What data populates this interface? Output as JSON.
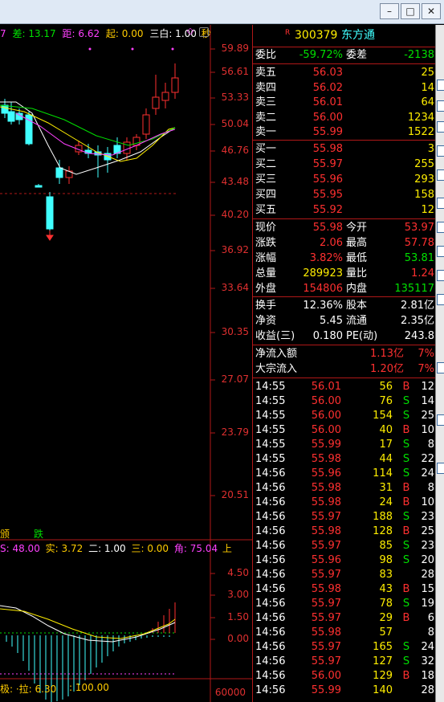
{
  "window": {
    "minimize_label": "–",
    "maximize_label": "□",
    "close_label": "✕"
  },
  "chart_header": {
    "items": [
      {
        "label": "7",
        "color": "#ff40ff"
      },
      {
        "label": "差: 13.17",
        "color": "#00e000"
      },
      {
        "label": "距: 6.62",
        "color": "#ff40ff"
      },
      {
        "label": "起: 0.00",
        "color": "#ffcc00"
      },
      {
        "label": "三白: 1.00",
        "color": "#ffffff"
      },
      {
        "label": "秒",
        "color": "#ffcc00"
      }
    ]
  },
  "price_axis": [
    "59.89",
    "56.61",
    "53.33",
    "50.04",
    "46.76",
    "43.48",
    "40.20",
    "36.92",
    "33.64",
    "30.35",
    "27.07",
    "23.79",
    "20.51"
  ],
  "lower_labels": {
    "left": "颁",
    "right": "跌"
  },
  "indicator_header": [
    {
      "label": "S: 48.00",
      "color": "#ff40ff"
    },
    {
      "label": "实: 3.72",
      "color": "#ffcc00"
    },
    {
      "label": "二: 1.00",
      "color": "#ffffff"
    },
    {
      "label": "三: 0.00",
      "color": "#ffcc00"
    },
    {
      "label": "角: 75.04",
      "color": "#ff40ff"
    },
    {
      "label": "上",
      "color": "#ffcc00"
    }
  ],
  "indicator_axis": [
    "4.50",
    "3.00",
    "1.50",
    "0.00"
  ],
  "indicator_footer": {
    "left": "极: ·拉: 6.30",
    "right": ": 100.00"
  },
  "volume_axis": "60000",
  "stock": {
    "code": "300379",
    "name": "东方通",
    "badge": "R"
  },
  "weibi": {
    "label1": "委比",
    "value1": "-59.72%",
    "label2": "委差",
    "value2": "-2138"
  },
  "asks": [
    {
      "label": "卖五",
      "price": "56.03",
      "vol": "25"
    },
    {
      "label": "卖四",
      "price": "56.02",
      "vol": "14"
    },
    {
      "label": "卖三",
      "price": "56.01",
      "vol": "64"
    },
    {
      "label": "卖二",
      "price": "56.00",
      "vol": "1234"
    },
    {
      "label": "卖一",
      "price": "55.99",
      "vol": "1522"
    }
  ],
  "bids": [
    {
      "label": "买一",
      "price": "55.98",
      "vol": "3"
    },
    {
      "label": "买二",
      "price": "55.97",
      "vol": "255"
    },
    {
      "label": "买三",
      "price": "55.96",
      "vol": "293"
    },
    {
      "label": "买四",
      "price": "55.95",
      "vol": "158"
    },
    {
      "label": "买五",
      "price": "55.92",
      "vol": "12"
    }
  ],
  "quote": [
    {
      "l1": "现价",
      "v1": "55.98",
      "c1": "#ff3030",
      "l2": "今开",
      "v2": "53.97",
      "c2": "#ff3030"
    },
    {
      "l1": "涨跌",
      "v1": "2.06",
      "c1": "#ff3030",
      "l2": "最高",
      "v2": "57.78",
      "c2": "#ff3030"
    },
    {
      "l1": "涨幅",
      "v1": "3.82%",
      "c1": "#ff3030",
      "l2": "最低",
      "v2": "53.81",
      "c2": "#00e000"
    },
    {
      "l1": "总量",
      "v1": "289923",
      "c1": "#ffee00",
      "l2": "量比",
      "v2": "1.24",
      "c2": "#ff3030"
    },
    {
      "l1": "外盘",
      "v1": "154806",
      "c1": "#ff3030",
      "l2": "内盘",
      "v2": "135117",
      "c2": "#00e000"
    }
  ],
  "fundamentals": [
    {
      "l1": "换手",
      "v1": "12.36%",
      "l2": "股本",
      "v2": "2.81亿"
    },
    {
      "l1": "净资",
      "v1": "5.45",
      "l2": "流通",
      "v2": "2.35亿"
    },
    {
      "l1": "收益(三)",
      "v1": "0.180",
      "l2": "PE(动)",
      "v2": "243.8"
    }
  ],
  "flows": [
    {
      "label": "净流入额",
      "value": "1.13亿",
      "pct": "7%"
    },
    {
      "label": "大宗流入",
      "value": "1.20亿",
      "pct": "7%"
    }
  ],
  "ticks": [
    {
      "t": "14:55",
      "p": "56.01",
      "v": "56",
      "s": "B",
      "n": "12"
    },
    {
      "t": "14:55",
      "p": "56.00",
      "v": "76",
      "s": "S",
      "n": "14"
    },
    {
      "t": "14:55",
      "p": "56.00",
      "v": "154",
      "s": "S",
      "n": "25"
    },
    {
      "t": "14:55",
      "p": "56.00",
      "v": "40",
      "s": "B",
      "n": "10"
    },
    {
      "t": "14:55",
      "p": "55.99",
      "v": "17",
      "s": "S",
      "n": "8"
    },
    {
      "t": "14:55",
      "p": "55.98",
      "v": "44",
      "s": "S",
      "n": "22"
    },
    {
      "t": "14:56",
      "p": "55.96",
      "v": "114",
      "s": "S",
      "n": "24"
    },
    {
      "t": "14:56",
      "p": "55.98",
      "v": "31",
      "s": "B",
      "n": "8"
    },
    {
      "t": "14:56",
      "p": "55.98",
      "v": "24",
      "s": "B",
      "n": "10"
    },
    {
      "t": "14:56",
      "p": "55.97",
      "v": "188",
      "s": "S",
      "n": "23"
    },
    {
      "t": "14:56",
      "p": "55.98",
      "v": "128",
      "s": "B",
      "n": "25"
    },
    {
      "t": "14:56",
      "p": "55.97",
      "v": "85",
      "s": "S",
      "n": "23"
    },
    {
      "t": "14:56",
      "p": "55.96",
      "v": "98",
      "s": "S",
      "n": "20"
    },
    {
      "t": "14:56",
      "p": "55.97",
      "v": "83",
      "s": "",
      "n": "28"
    },
    {
      "t": "14:56",
      "p": "55.98",
      "v": "43",
      "s": "B",
      "n": "15"
    },
    {
      "t": "14:56",
      "p": "55.97",
      "v": "78",
      "s": "S",
      "n": "19"
    },
    {
      "t": "14:56",
      "p": "55.97",
      "v": "29",
      "s": "B",
      "n": "6"
    },
    {
      "t": "14:56",
      "p": "55.98",
      "v": "57",
      "s": "",
      "n": "8"
    },
    {
      "t": "14:56",
      "p": "55.97",
      "v": "165",
      "s": "S",
      "n": "24"
    },
    {
      "t": "14:56",
      "p": "55.97",
      "v": "127",
      "s": "S",
      "n": "32"
    },
    {
      "t": "14:56",
      "p": "56.00",
      "v": "129",
      "s": "B",
      "n": "18"
    },
    {
      "t": "14:56",
      "p": "55.99",
      "v": "140",
      "s": "",
      "n": "28"
    }
  ],
  "colors": {
    "up": "#ff3030",
    "down": "#00e000",
    "neutral": "#ffffff",
    "grid": "#b01818",
    "cyan": "#40ffff",
    "yellow": "#ffee00"
  }
}
